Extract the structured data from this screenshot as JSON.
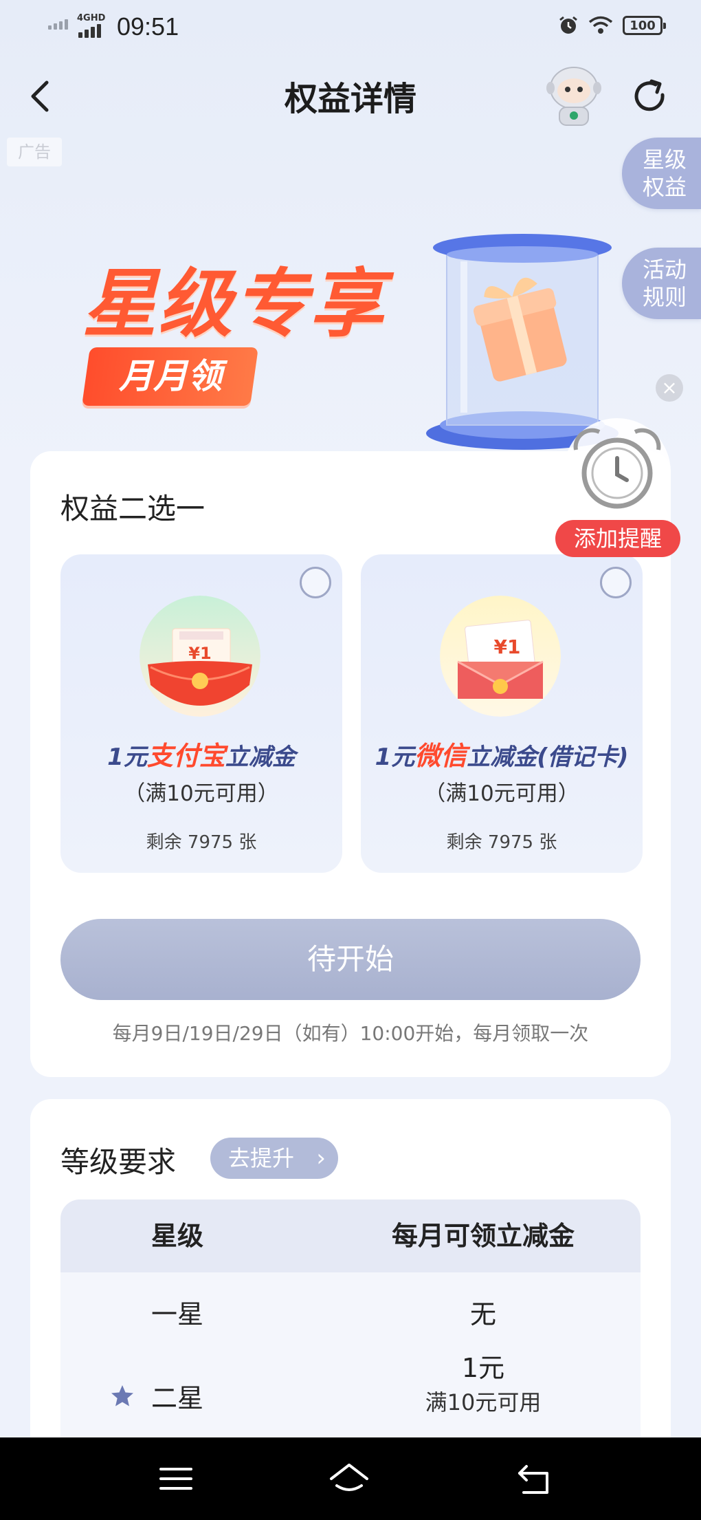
{
  "status_bar": {
    "network": "4GHD",
    "time": "09:51",
    "battery": "100"
  },
  "nav": {
    "title": "权益详情"
  },
  "ad_label": "广告",
  "side_tabs": [
    {
      "line1": "星级",
      "line2": "权益"
    },
    {
      "line1": "活动",
      "line2": "规则"
    }
  ],
  "banner": {
    "title": "星级专享",
    "badge": "月月领"
  },
  "reminder": {
    "label": "添加提醒"
  },
  "benefit_choice": {
    "heading": "权益二选一",
    "options": [
      {
        "amount": "1元",
        "brand": "支付宝",
        "suffix": "立减金",
        "condition": "（满10元可用）",
        "remaining": "剩余 7975 张",
        "card_label": "支付宝红包",
        "card_value": "¥1"
      },
      {
        "amount": "1元",
        "brand": "微信",
        "suffix": "立减金(借记卡)",
        "condition": "（满10元可用）",
        "remaining": "剩余 7975 张",
        "card_value": "¥1"
      }
    ],
    "button_label": "待开始",
    "schedule": "每月9日/19日/29日（如有）10:00开始，每月领取一次"
  },
  "level_requirements": {
    "heading": "等级要求",
    "upgrade_label": "去提升",
    "columns": [
      "星级",
      "每月可领立减金"
    ],
    "rows": [
      {
        "level": "一星",
        "amount": "无",
        "sub": ""
      },
      {
        "level": "二星",
        "amount": "1元",
        "sub": "满10元可用"
      }
    ]
  },
  "colors": {
    "accent_orange": "#ff5a33",
    "brand_navy": "#3b4a8c",
    "button_disabled": "#aeb6d3",
    "reminder_red": "#f04848",
    "side_tab": "#a9b3dc"
  }
}
